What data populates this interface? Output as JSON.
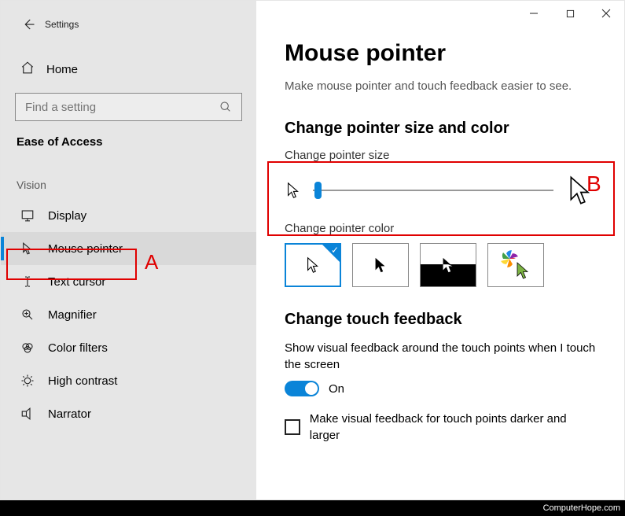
{
  "window": {
    "app_name": "Settings",
    "minimize": "—",
    "maximize": "☐",
    "close": "✕"
  },
  "sidebar": {
    "back_icon": "←",
    "home_label": "Home",
    "search_placeholder": "Find a setting",
    "category": "Ease of Access",
    "group": "Vision",
    "items": [
      {
        "icon": "display",
        "label": "Display"
      },
      {
        "icon": "mouse",
        "label": "Mouse pointer"
      },
      {
        "icon": "text-cursor",
        "label": "Text cursor"
      },
      {
        "icon": "magnifier",
        "label": "Magnifier"
      },
      {
        "icon": "color-filters",
        "label": "Color filters"
      },
      {
        "icon": "high-contrast",
        "label": "High contrast"
      },
      {
        "icon": "narrator",
        "label": "Narrator"
      }
    ]
  },
  "page": {
    "title": "Mouse pointer",
    "subtitle": "Make mouse pointer and touch feedback easier to see.",
    "section_size_color": "Change pointer size and color",
    "size_label": "Change pointer size",
    "color_label": "Change pointer color",
    "color_options": [
      "white-black-outline",
      "solid-black",
      "inverted",
      "custom-color"
    ],
    "section_touch": "Change touch feedback",
    "touch_desc": "Show visual feedback around the touch points when I touch the screen",
    "toggle_state": "On",
    "check_label": "Make visual feedback for touch points darker and larger"
  },
  "annotations": {
    "a": "A",
    "b": "B"
  },
  "footer": "ComputerHope.com"
}
